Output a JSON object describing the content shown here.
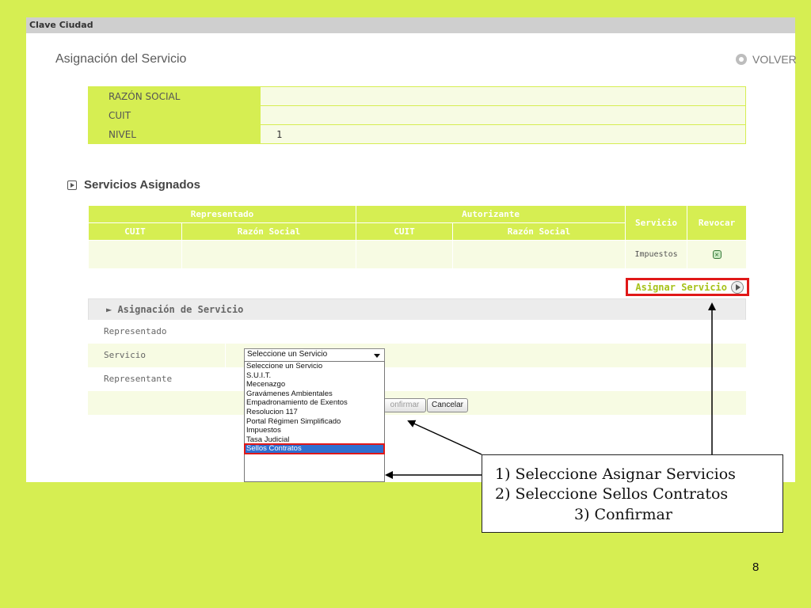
{
  "window": {
    "title": "Clave Ciudad"
  },
  "page": {
    "title": "Asignación del Servicio",
    "back_label": "VOLVER",
    "slide_number": "8"
  },
  "info": [
    {
      "label": "RAZÓN SOCIAL",
      "value": ""
    },
    {
      "label": "CUIT",
      "value": ""
    },
    {
      "label": "NIVEL",
      "value": "1"
    }
  ],
  "section": {
    "title": "Servicios Asignados"
  },
  "services_table": {
    "group_headers": [
      "Representado",
      "Autorizante"
    ],
    "headers": [
      "CUIT",
      "Razón Social",
      "CUIT",
      "Razón Social",
      "Servicio",
      "Revocar"
    ],
    "rows": [
      {
        "servicio": "Impuestos"
      }
    ]
  },
  "assign_button": "Asignar Servicio",
  "panel": {
    "title": "► Asignación de Servicio",
    "labels": [
      "Representado",
      "Servicio",
      "Representante"
    ],
    "select_value": "Seleccione un Servicio",
    "options": [
      "Seleccione un Servicio",
      "S.U.I.T.",
      "Mecenazgo",
      "Gravámenes Ambientales",
      "Empadronamiento de Exentos",
      "Resolucion 117",
      "Portal Régimen Simplificado",
      "Impuestos",
      "Tasa Judicial",
      "Sellos Contratos"
    ],
    "confirm_label": "onfirmar",
    "cancel_label": "Cancelar",
    "partial_text": ":"
  },
  "instructions": [
    "1)  Seleccione Asignar Servicios",
    "2)  Seleccione Sellos Contratos",
    "3)  Confirmar"
  ],
  "colors": {
    "background": "#d6ee52",
    "highlight": "#e01818",
    "selected": "#2f6fd0"
  }
}
